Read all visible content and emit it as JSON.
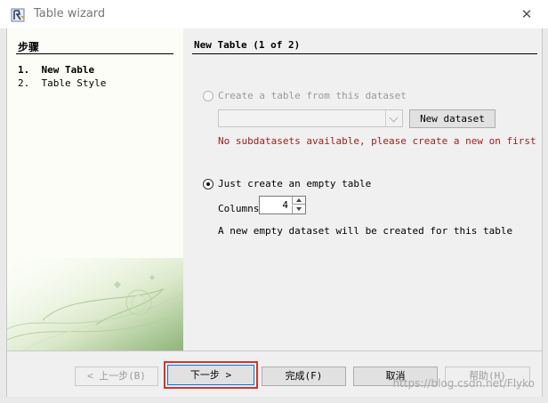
{
  "window": {
    "title": "Table wizard",
    "close_glyph": "✕"
  },
  "steps": {
    "header": "步骤",
    "items": [
      {
        "label": "1.  New Table",
        "active": true
      },
      {
        "label": "2.  Table Style",
        "active": false
      }
    ]
  },
  "page": {
    "title": "New Table (1 of 2)",
    "option_dataset": {
      "label": "Create a table from this dataset",
      "selected": false,
      "enabled": false
    },
    "dataset_select": {
      "value": "",
      "enabled": false
    },
    "new_dataset_button": "New dataset",
    "error_message": "No subdatasets available, please create a new on first",
    "option_empty": {
      "label": "Just create an empty table",
      "selected": true
    },
    "columns": {
      "label": "Columns",
      "value": "4"
    },
    "info_message": "A new empty dataset will be created for this table"
  },
  "buttons": {
    "back": "< 上一步(B)",
    "next": "下一步 >",
    "finish": "完成(F)",
    "cancel": "取消",
    "help": "帮助(H)"
  },
  "watermark": "https://blog.csdn.net/Flyko",
  "colors": {
    "error_text": "#a0201a",
    "highlight": "#d9332a"
  }
}
